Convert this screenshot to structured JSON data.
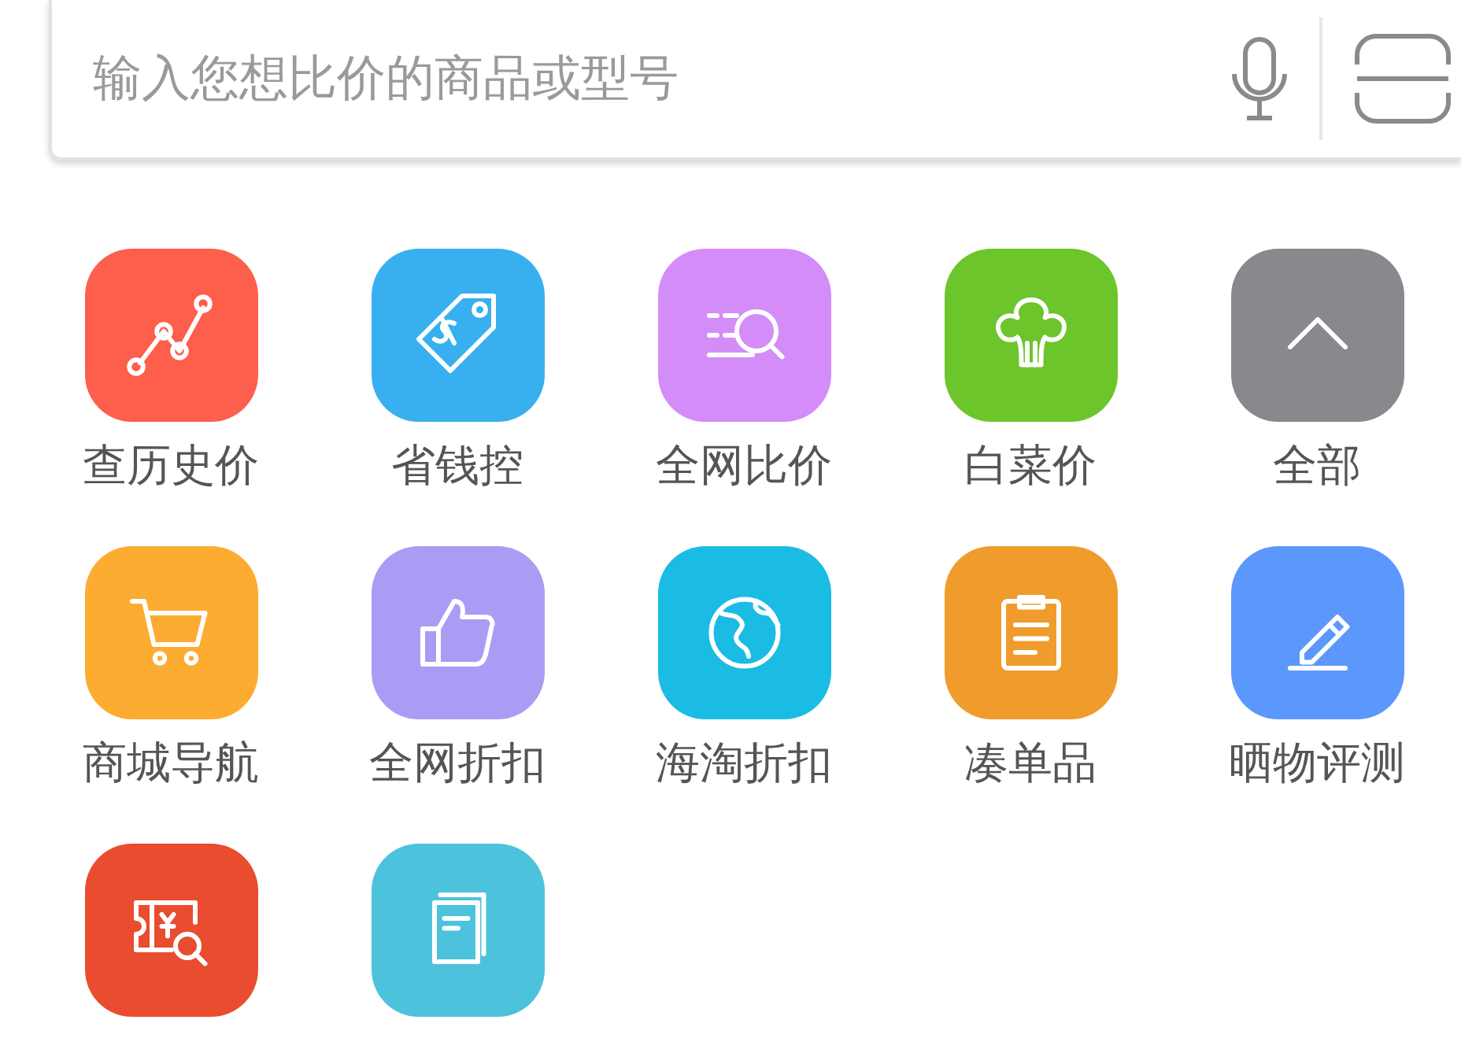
{
  "search": {
    "placeholder": "输入您想比价的商品或型号"
  },
  "shortcuts": [
    {
      "label": "查历史价",
      "kind": "trend",
      "color": "#fe5e4c"
    },
    {
      "label": "省钱控",
      "kind": "tag",
      "color": "#38b0ef"
    },
    {
      "label": "全网比价",
      "kind": "search",
      "color": "#d48cf8"
    },
    {
      "label": "白菜价",
      "kind": "cabbage",
      "color": "#6cc52b"
    },
    {
      "label": "全部",
      "kind": "collapse",
      "color": "#88898c"
    },
    {
      "label": "商城导航",
      "kind": "cart",
      "color": "#fdac32"
    },
    {
      "label": "全网折扣",
      "kind": "thumb",
      "color": "#ac9bf4"
    },
    {
      "label": "海淘折扣",
      "kind": "globe",
      "color": "#1bbce4"
    },
    {
      "label": "凑单品",
      "kind": "clipboard",
      "color": "#f09c2c"
    },
    {
      "label": "晒物评测",
      "kind": "pencil",
      "color": "#5c98fc"
    },
    {
      "kind": "coupon",
      "color": "#e94c2e"
    },
    {
      "kind": "book",
      "color": "#4dc2dc"
    }
  ]
}
